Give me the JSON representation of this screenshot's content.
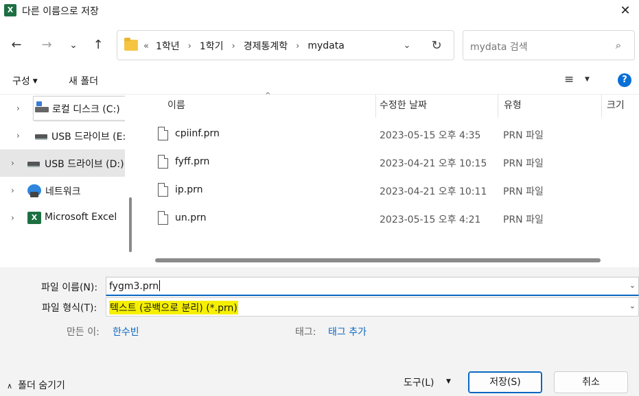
{
  "window": {
    "title": "다른 이름으로 저장",
    "app_icon_letter": "X",
    "close_glyph": "✕"
  },
  "nav": {
    "back_glyph": "←",
    "forward_glyph": "→",
    "recent_glyph": "⌄",
    "up_glyph": "↑"
  },
  "address": {
    "overflow": "«",
    "crumbs": [
      "1학년",
      "1학기",
      "경제통계학",
      "mydata"
    ],
    "separator": "›",
    "dropdown_glyph": "⌄",
    "refresh_glyph": "↻"
  },
  "search": {
    "placeholder": "mydata 검색",
    "icon_glyph": "⌕"
  },
  "toolbar": {
    "organize": "구성",
    "organize_caret": "▼",
    "new_folder": "새 폴더",
    "view_glyph": "≡",
    "view_caret": "▼",
    "help_glyph": "?"
  },
  "sidebar": {
    "items": [
      {
        "label": "로컬 디스크 (C:)",
        "icon": "local-disk-icon",
        "expander": "›"
      },
      {
        "label": "USB 드라이브 (E:)",
        "icon": "usb-drive-icon",
        "expander": "›"
      },
      {
        "label": "USB 드라이브 (D:)",
        "icon": "usb-drive-icon",
        "expander": "›",
        "selected": true
      },
      {
        "label": "네트워크",
        "icon": "network-icon",
        "expander": "›"
      },
      {
        "label": "Microsoft Excel",
        "icon": "excel-icon",
        "expander": "›"
      }
    ],
    "excel_letter": "X"
  },
  "files": {
    "columns": [
      "이름",
      "수정한 날짜",
      "유형",
      "크기"
    ],
    "sort_glyph": "^",
    "rows": [
      {
        "name": "cpiinf.prn",
        "date": "2023-05-15 오후 4:35",
        "type": "PRN 파일"
      },
      {
        "name": "fyff.prn",
        "date": "2023-04-21 오후 10:15",
        "type": "PRN 파일"
      },
      {
        "name": "ip.prn",
        "date": "2023-04-21 오후 10:11",
        "type": "PRN 파일"
      },
      {
        "name": "un.prn",
        "date": "2023-05-15 오후 4:21",
        "type": "PRN 파일"
      }
    ]
  },
  "form": {
    "filename_label": "파일 이름(N):",
    "filename_value": "fygm3.prn",
    "filetype_label": "파일 형식(T):",
    "filetype_value": "텍스트 (공백으로 분리) (*.prn)",
    "chevron_glyph": "⌄",
    "author_label": "만든 이:",
    "author_value": "한수빈",
    "tags_label": "태그:",
    "tags_value": "태그 추가"
  },
  "footer": {
    "hide_folders_glyph": "∧",
    "hide_folders": "폴더 숨기기",
    "tools": "도구(L)",
    "tools_caret": "▼",
    "save": "저장(S)",
    "cancel": "취소"
  },
  "colors": {
    "accent": "#0a66c2",
    "highlight": "#f6f000",
    "excel_green": "#1d6f42"
  }
}
